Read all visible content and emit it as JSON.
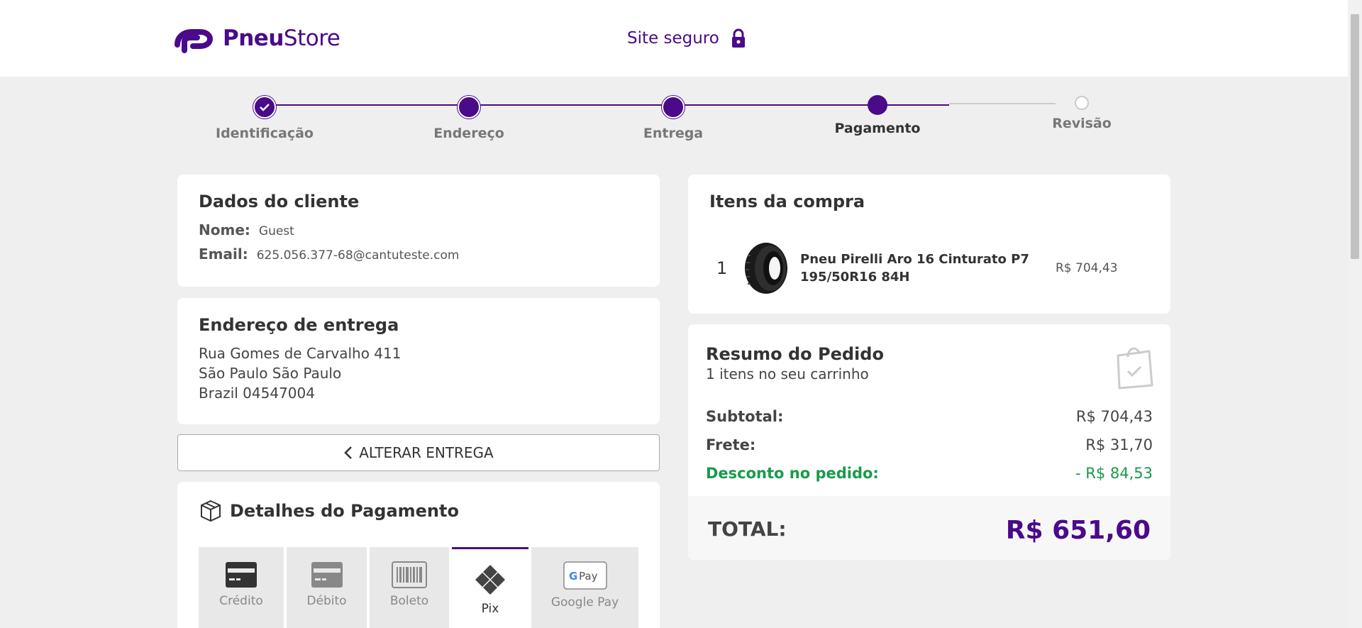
{
  "header": {
    "brand_bold": "Pneu",
    "brand_light": "Store",
    "secure_label": "Site seguro"
  },
  "stepper": {
    "steps": [
      {
        "label": "Identificação",
        "state": "done"
      },
      {
        "label": "Endereço",
        "state": "done"
      },
      {
        "label": "Entrega",
        "state": "done"
      },
      {
        "label": "Pagamento",
        "state": "active"
      },
      {
        "label": "Revisão",
        "state": "pending"
      }
    ]
  },
  "customer": {
    "title": "Dados do cliente",
    "name_label": "Nome:",
    "name_value": "Guest",
    "email_label": "Email:",
    "email_value": "625.056.377-68@cantuteste.com"
  },
  "address": {
    "title": "Endereço de entrega",
    "lines": [
      "Rua Gomes de Carvalho 411",
      "São Paulo São Paulo",
      "Brazil 04547004"
    ]
  },
  "change_delivery_label": "ALTERAR ENTREGA",
  "payment": {
    "title": "Detalhes do Pagamento",
    "tabs": [
      {
        "label": "Crédito",
        "icon": "credit-card-icon"
      },
      {
        "label": "Débito",
        "icon": "debit-card-icon"
      },
      {
        "label": "Boleto",
        "icon": "barcode-icon"
      },
      {
        "label": "Pix",
        "icon": "pix-icon",
        "active": true
      },
      {
        "label": "Google Pay",
        "icon": "google-pay-icon"
      }
    ]
  },
  "items": {
    "title": "Itens da compra",
    "list": [
      {
        "qty": "1",
        "name": "Pneu Pirelli Aro 16 Cinturato P7 195/50R16 84H",
        "price": "R$ 704,43"
      }
    ]
  },
  "summary": {
    "title": "Resumo do Pedido",
    "subtitle": "1 itens no seu carrinho",
    "subtotal_label": "Subtotal:",
    "subtotal_value": "R$ 704,43",
    "shipping_label": "Frete:",
    "shipping_value": "R$ 31,70",
    "discount_label": "Desconto no pedido:",
    "discount_value": "- R$ 84,53",
    "total_label": "TOTAL:",
    "total_value": "R$ 651,60"
  },
  "colors": {
    "brand": "#4a0a8a",
    "discount": "#1a9a4a"
  }
}
